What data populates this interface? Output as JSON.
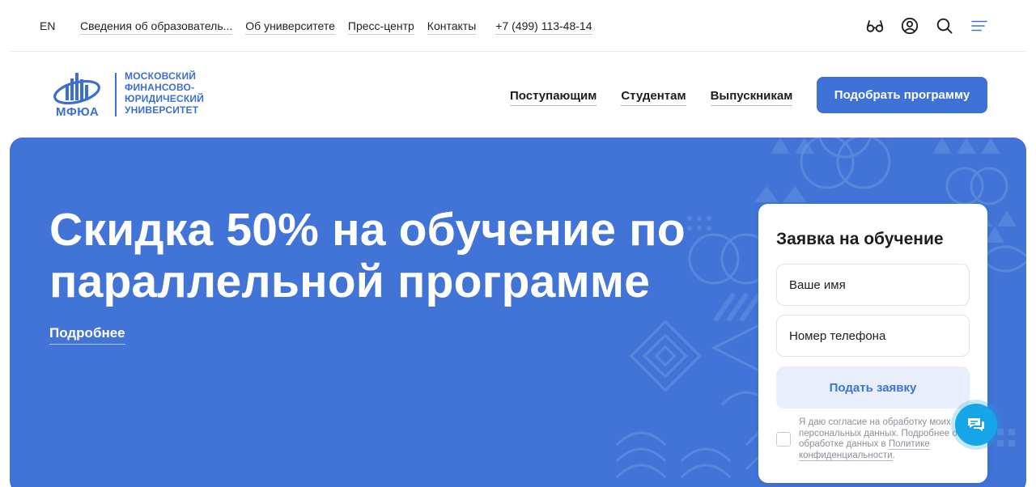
{
  "topbar": {
    "lang": "EN",
    "nav": [
      "Сведения об образователь...",
      "Об университете",
      "Пресс-центр",
      "Контакты"
    ],
    "phone": "+7 (499) 113-48-14",
    "icons": [
      "glasses-icon",
      "user-icon",
      "search-icon",
      "menu-icon"
    ]
  },
  "logo": {
    "abbr": "МФЮА",
    "name_lines": [
      "МОСКОВСКИЙ",
      "ФИНАНСОВО-",
      "ЮРИДИЧЕСКИЙ",
      "УНИВЕРСИТЕТ"
    ]
  },
  "mainnav": {
    "items": [
      "Поступающим",
      "Студентам",
      "Выпускникам"
    ],
    "cta": "Подобрать программу"
  },
  "hero": {
    "title_line1": "Скидка 50% на обучение по",
    "title_line2": "параллельной программе",
    "more": "Подробнее"
  },
  "form": {
    "title": "Заявка на обучение",
    "name_placeholder": "Ваше имя",
    "phone_placeholder": "Номер телефона",
    "submit": "Подать заявку",
    "consent_text": "Я даю согласие на обработку моих персональных данных. Подробнее об обработке данных в ",
    "consent_link": "Политике конфиденциальности",
    "consent_end": "."
  },
  "colors": {
    "brand": "#3f72d6",
    "hero_bg": "#4174d6",
    "chat": "#16a5e6"
  }
}
